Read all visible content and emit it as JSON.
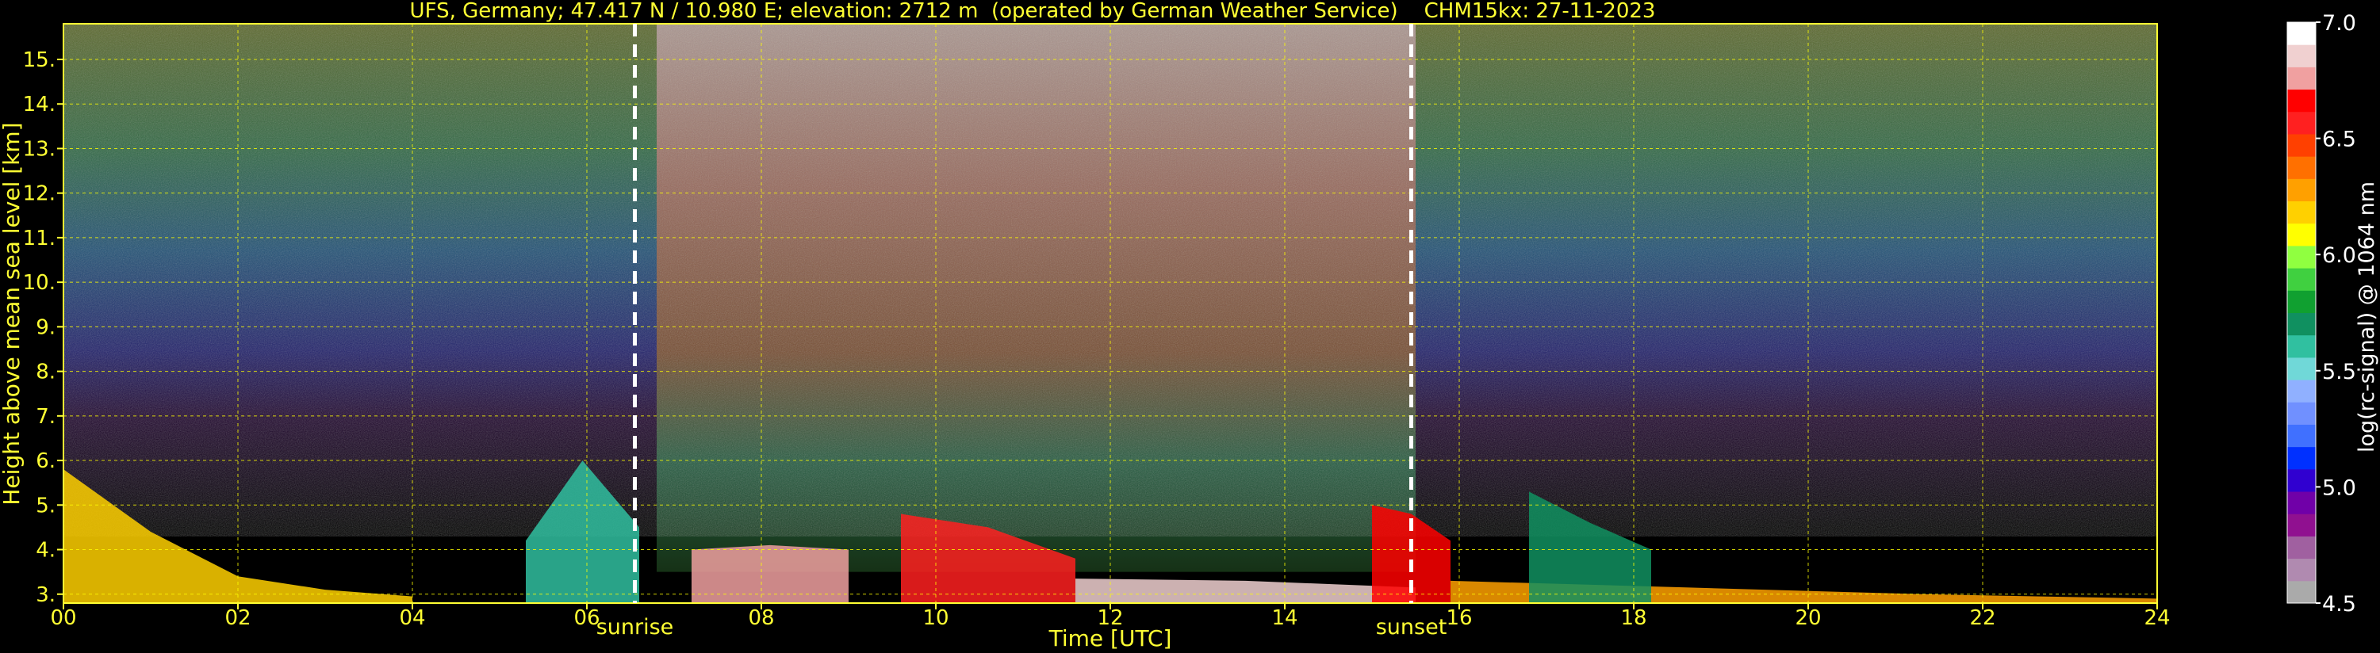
{
  "chart_data": {
    "type": "heatmap",
    "title": "UFS, Germany; 47.417 N / 10.980 E; elevation: 2712 m  (operated by German Weather Service)    CHM15kx: 27-11-2023",
    "xlabel": "Time [UTC]",
    "ylabel": "Height above mean sea level [km]",
    "xlim": [
      0,
      24
    ],
    "ylim": [
      2.8,
      15.8
    ],
    "x_ticks": [
      "00",
      "02",
      "04",
      "06",
      "08",
      "10",
      "12",
      "14",
      "16",
      "18",
      "20",
      "22",
      "24"
    ],
    "y_ticks": [
      "3.",
      "4.",
      "5.",
      "6.",
      "7.",
      "8.",
      "9.",
      "10.",
      "11.",
      "12.",
      "13.",
      "14.",
      "15."
    ],
    "grid": true,
    "grid_color": "#ffff00",
    "annotations": [
      {
        "text": "sunrise",
        "x": 6.55
      },
      {
        "text": "sunset",
        "x": 15.45
      }
    ],
    "colorbar": {
      "label": "log(rc-signal) @ 1064 nm",
      "range": [
        4.5,
        7.0
      ],
      "ticks": [
        "4.5",
        "5.0",
        "5.5",
        "6.0",
        "6.5",
        "7.0"
      ],
      "colors": [
        "#aaaaaa",
        "#b08ab0",
        "#a060a0",
        "#901090",
        "#7000a8",
        "#3000d0",
        "#0030ff",
        "#4070ff",
        "#7090ff",
        "#90b0ff",
        "#70d8d8",
        "#30c0a0",
        "#109060",
        "#10a030",
        "#40d040",
        "#90ff40",
        "#ffff00",
        "#ffd000",
        "#ffa000",
        "#ff7000",
        "#ff4000",
        "#ff2020",
        "#ff0000",
        "#f0a0a0",
        "#f0d0d0",
        "#ffffff"
      ]
    },
    "background_layers": [
      {
        "name": "noise-night-left",
        "x": [
          0,
          6.8
        ],
        "y": [
          4.5,
          15.8
        ],
        "level": "blue-green noise increasing with height"
      },
      {
        "name": "daytime-solar-background",
        "x": [
          6.8,
          15.5
        ],
        "y": [
          3.5,
          15.8
        ],
        "level": "red-white noise"
      },
      {
        "name": "noise-night-right",
        "x": [
          15.5,
          24
        ],
        "y": [
          4.5,
          15.8
        ],
        "level": "blue-green noise increasing with height"
      }
    ],
    "features": [
      {
        "name": "boundary-layer-aerosol-early",
        "x": [
          0,
          4
        ],
        "top": [
          5.8,
          4.4,
          3.4,
          3.1,
          2.95
        ],
        "value": 6.2
      },
      {
        "name": "aerosol-plume-0530",
        "x": [
          5.3,
          6.6
        ],
        "top": [
          4.2,
          6.0,
          4.5
        ],
        "value": 5.6
      },
      {
        "name": "cloud-layer-morning",
        "x": [
          7.2,
          9.0
        ],
        "top": [
          4.0,
          4.1,
          4.0
        ],
        "value": 6.8
      },
      {
        "name": "convective-mixing-noon",
        "x": [
          9.6,
          11.6
        ],
        "top": [
          4.8,
          4.5,
          3.8
        ],
        "value": 6.6
      },
      {
        "name": "cloud-base-afternoon",
        "x": [
          11.6,
          15.5
        ],
        "top": [
          3.35,
          3.3,
          3.15
        ],
        "value": 6.9
      },
      {
        "name": "evening-plume",
        "x": [
          15.0,
          15.9
        ],
        "top": [
          5.0,
          4.8,
          4.2
        ],
        "value": 6.7
      },
      {
        "name": "evening-aerosol-layer",
        "x": [
          15.9,
          24
        ],
        "top": [
          3.3,
          3.15,
          3.0,
          2.9
        ],
        "value": 6.3
      },
      {
        "name": "isolated-plumes-17h",
        "x": [
          16.8,
          18.2
        ],
        "top": [
          5.3,
          4.6,
          4.0
        ],
        "value": 5.7
      }
    ]
  }
}
